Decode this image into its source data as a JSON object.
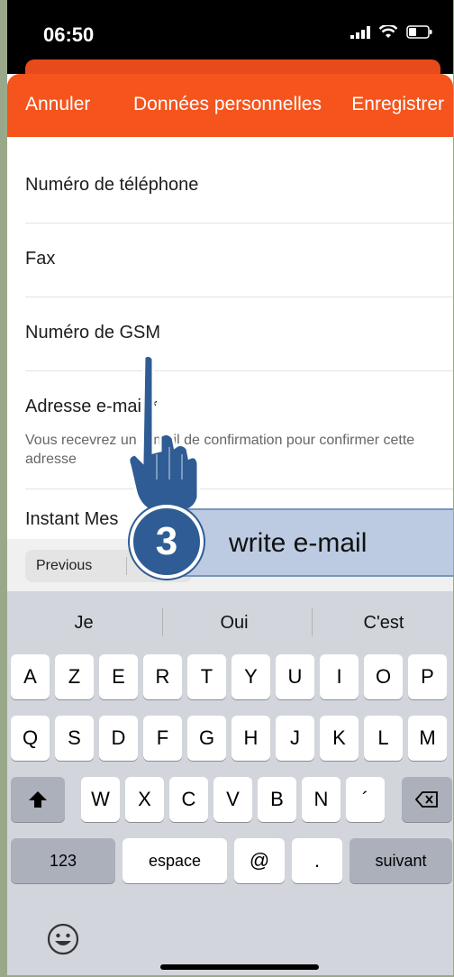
{
  "status_bar": {
    "time": "06:50"
  },
  "nav": {
    "cancel": "Annuler",
    "title": "Données personnelles",
    "save": "Enregistrer"
  },
  "form": {
    "phone": "Numéro de téléphone",
    "fax": "Fax",
    "gsm": "Numéro de GSM",
    "email_label": "Adresse e-mail *",
    "email_hint": "Vous recevrez un e-mail de confirmation pour confirmer cette adresse",
    "instant": "Instant Mes"
  },
  "accessory": {
    "previous": "Previous"
  },
  "keyboard": {
    "suggestions": [
      "Je",
      "Oui",
      "C'est"
    ],
    "row1": [
      "A",
      "Z",
      "E",
      "R",
      "T",
      "Y",
      "U",
      "I",
      "O",
      "P"
    ],
    "row2": [
      "Q",
      "S",
      "D",
      "F",
      "G",
      "H",
      "J",
      "K",
      "L",
      "M"
    ],
    "row3": [
      "W",
      "X",
      "C",
      "V",
      "B",
      "N",
      "´"
    ],
    "numbers": "123",
    "space": "espace",
    "at": "@",
    "dot": ".",
    "next": "suivant"
  },
  "tutorial": {
    "step": "3",
    "instruction": "write e-mail"
  },
  "colors": {
    "accent": "#f5541d",
    "callout_bg": "#bccbe2",
    "badge": "#2f5c94"
  }
}
